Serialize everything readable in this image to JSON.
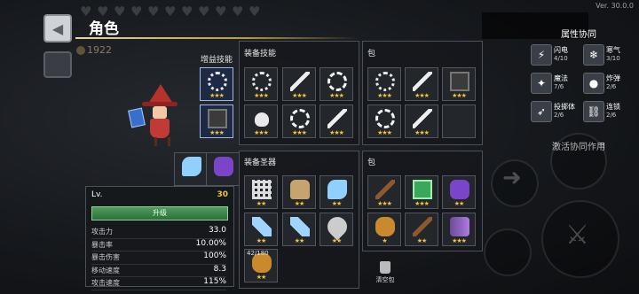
{
  "version": "Ver. 30.0.0",
  "header": {
    "title": "角色",
    "gold": "1922"
  },
  "sections": {
    "buff_skills": "增益技能",
    "equip_skills": "装备技能",
    "bag_top": "包",
    "equip_relics": "装备圣器",
    "bag_bottom": "包"
  },
  "buff_slots": [
    {
      "icon": "skull-icon",
      "stars": "★★★"
    },
    {
      "icon": "scroll-icon",
      "stars": "★★★"
    }
  ],
  "hero_items": [
    {
      "icon": "spellbook-icon"
    },
    {
      "icon": "purple-creature-icon"
    }
  ],
  "equip_skill_slots": [
    {
      "icon": "gear-icon",
      "stars": "★★★"
    },
    {
      "icon": "lightning-icon",
      "stars": "★★★"
    },
    {
      "icon": "burst-icon",
      "stars": "★★★"
    },
    {
      "icon": "flask-icon",
      "stars": "★★★"
    },
    {
      "icon": "burst-icon",
      "stars": "★★★"
    },
    {
      "icon": "lightning-icon",
      "stars": "★★★"
    }
  ],
  "bag_skill_slots": [
    {
      "icon": "skull-icon",
      "stars": "★★★"
    },
    {
      "icon": "lightning-icon",
      "stars": "★★★"
    },
    {
      "icon": "scroll-icon",
      "stars": "★★★"
    },
    {
      "icon": "burst-icon",
      "stars": "★★★"
    },
    {
      "icon": "lightning-icon",
      "stars": "★★★"
    },
    {
      "icon": "",
      "stars": ""
    }
  ],
  "relic_slots": [
    {
      "icon": "grid-icon",
      "stars": "★★"
    },
    {
      "icon": "bag-icon",
      "stars": "★★"
    },
    {
      "icon": "crystal-icon",
      "stars": "★★"
    },
    {
      "icon": "shard-icon",
      "stars": "★★"
    },
    {
      "icon": "shard-icon",
      "stars": "★★"
    },
    {
      "icon": "drop-icon",
      "stars": "★★"
    },
    {
      "icon": "potion-icon",
      "stars": "★★",
      "count": "42/180"
    }
  ],
  "bag_relic_slots": [
    {
      "icon": "stick-icon",
      "stars": "★★★"
    },
    {
      "icon": "cube-icon",
      "stars": "★★★"
    },
    {
      "icon": "purple-icon",
      "stars": "★★"
    },
    {
      "icon": "potion-icon",
      "stars": "★"
    },
    {
      "icon": "stick-icon",
      "stars": "★★"
    },
    {
      "icon": "pile-icon",
      "stars": "★★★"
    }
  ],
  "stats": {
    "lv_label": "Lv.",
    "lv_value": "30",
    "upgrade_label": "升级",
    "rows": [
      {
        "k": "攻击力",
        "v": "33.0"
      },
      {
        "k": "暴击率",
        "v": "10.00%"
      },
      {
        "k": "暴击伤害",
        "v": "100%"
      },
      {
        "k": "移动速度",
        "v": "8.3"
      },
      {
        "k": "攻击速度",
        "v": "115%"
      }
    ]
  },
  "clear_bag": "清空包",
  "synergy": {
    "title": "属性协同",
    "items": [
      {
        "name": "闪电",
        "count": "4/10",
        "icon": "⚡"
      },
      {
        "name": "寒气",
        "count": "3/10",
        "icon": "❄"
      },
      {
        "name": "魔法",
        "count": "7/6",
        "icon": "✦"
      },
      {
        "name": "炸弹",
        "count": "2/6",
        "icon": "●"
      },
      {
        "name": "投掷体",
        "count": "2/6",
        "icon": "➶"
      },
      {
        "name": "连锁",
        "count": "2/6",
        "icon": "⛓"
      }
    ],
    "activate": "激活协同作用"
  }
}
